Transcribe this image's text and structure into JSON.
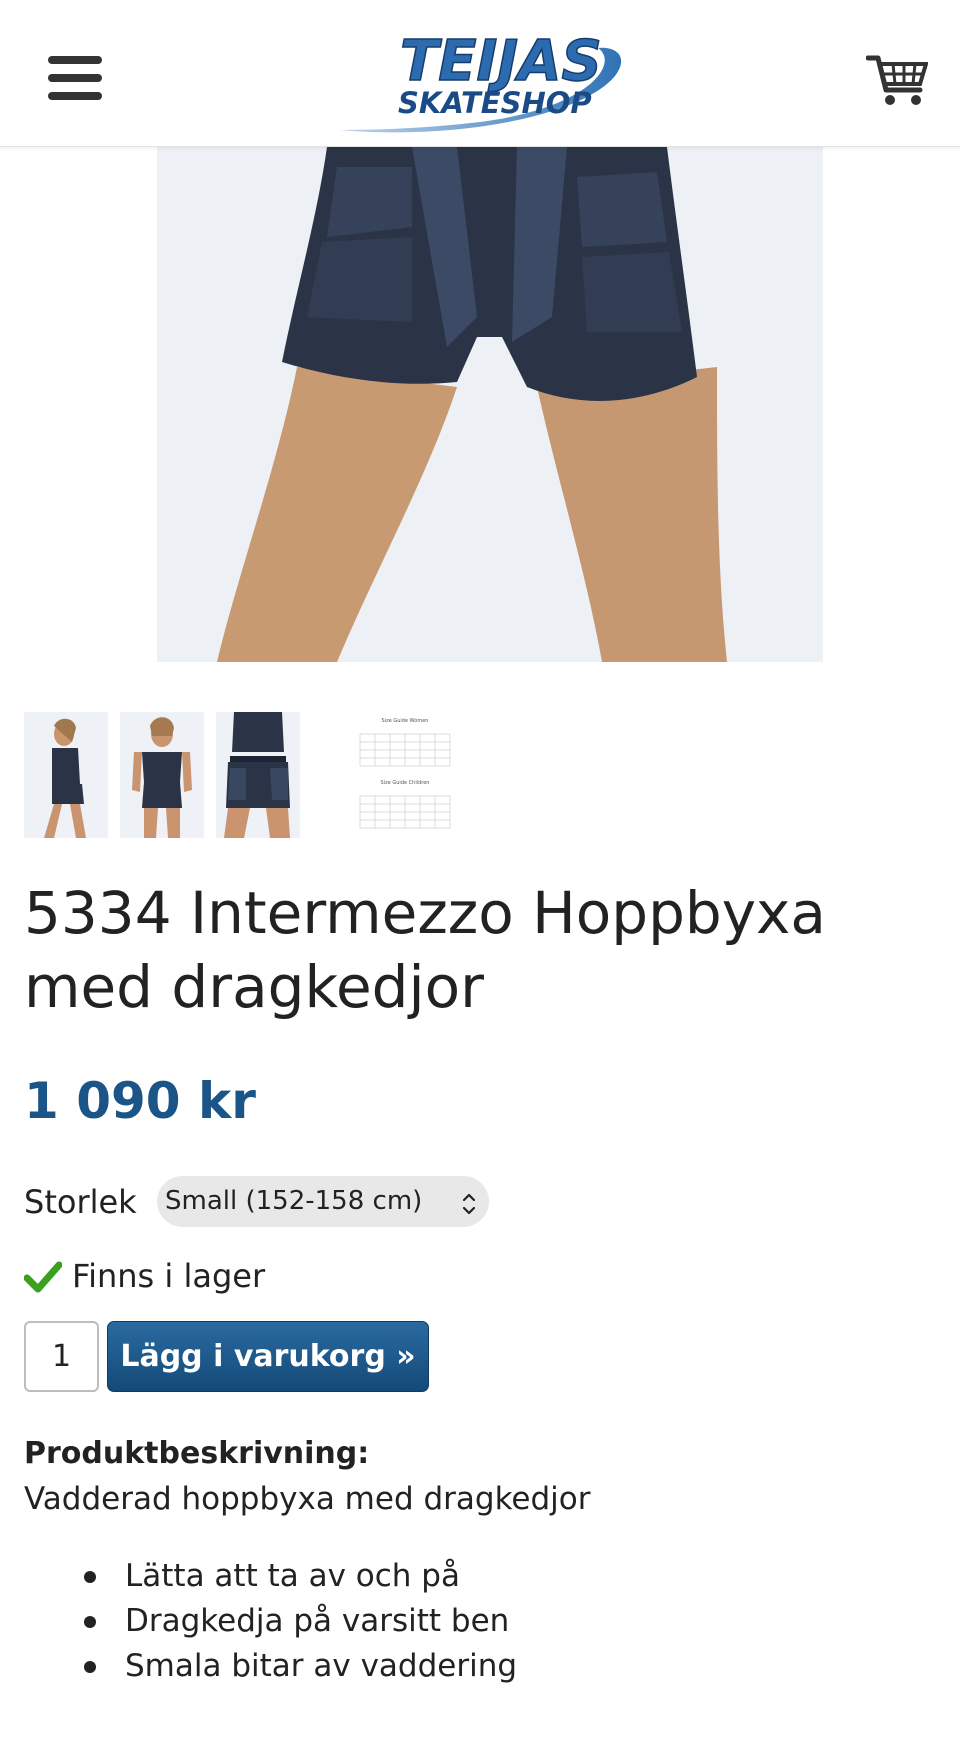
{
  "header": {
    "menu_icon": "hamburger-menu-icon",
    "logo": {
      "line1": "TEIJAS",
      "line2": "SKATESHOP"
    },
    "cart_icon": "shopping-cart-icon"
  },
  "product": {
    "title": "5334 Intermezzo Hoppbyxa med dragkedjor",
    "price": "1 090 kr",
    "size_label": "Storlek",
    "size_selected": "Small (152-158 cm)",
    "stock_status": "Finns i lager",
    "quantity": "1",
    "add_to_cart_label": "Lägg i varukorg »",
    "description_heading": "Produktbeskrivning:",
    "description": "Vadderad hoppbyxa med dragkedjor",
    "features": [
      "Lätta att ta av och på",
      "Dragkedja på varsitt ben",
      "Smala bitar av vaddering"
    ]
  },
  "thumbnails": [
    {
      "name": "thumbnail-side-view"
    },
    {
      "name": "thumbnail-front-view"
    },
    {
      "name": "thumbnail-closeup"
    },
    {
      "name": "thumbnail-size-guide",
      "caption_1": "Size Guide Women",
      "caption_2": "Size Guide Children"
    }
  ],
  "colors": {
    "brand_blue": "#1b5587",
    "button_blue": "#1e5a8c",
    "stock_green": "#3aa01e"
  }
}
